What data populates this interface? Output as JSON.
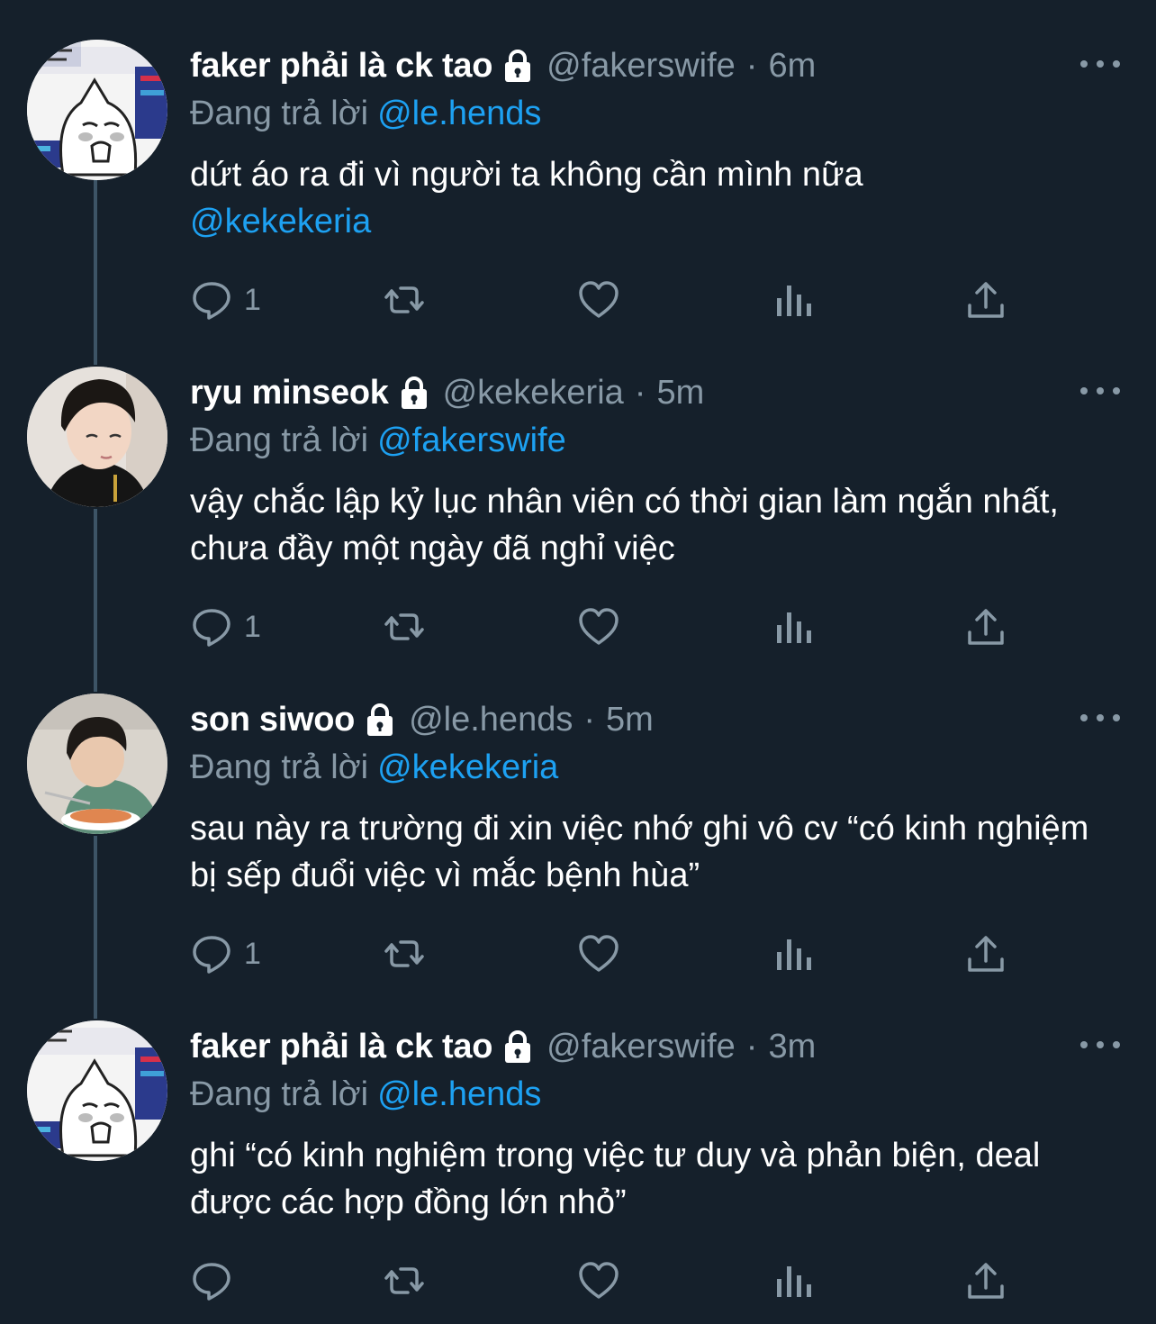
{
  "colors": {
    "background": "#15202b",
    "secondary_text": "#8899a6",
    "link": "#1da1f2",
    "thread_line": "#3d5466"
  },
  "icons": {
    "protected": "lock-icon",
    "more": "more-dots-icon",
    "reply": "reply-icon",
    "retweet": "retweet-icon",
    "like": "like-icon",
    "analytics": "analytics-icon",
    "share": "share-icon"
  },
  "tweets": [
    {
      "display_name": "faker phải là ck tao",
      "handle": "@fakerswife",
      "separator": "·",
      "time": "6m",
      "reply_prefix": "Đang trả lời",
      "reply_to": "@le.hends",
      "text": "dứt áo ra đi vì người ta không cần mình nữa",
      "text_mention": "@kekekeria",
      "reply_count": "1"
    },
    {
      "display_name": "ryu minseok",
      "handle": "@kekekeria",
      "separator": "·",
      "time": "5m",
      "reply_prefix": "Đang trả lời",
      "reply_to": "@fakerswife",
      "text": "vậy chắc lập kỷ lục nhân viên có thời gian làm ngắn nhất, chưa đầy một ngày đã nghỉ việc",
      "reply_count": "1"
    },
    {
      "display_name": "son siwoo",
      "handle": "@le.hends",
      "separator": "·",
      "time": "5m",
      "reply_prefix": "Đang trả lời",
      "reply_to": "@kekekeria",
      "text": "sau này ra trường đi xin việc nhớ ghi vô cv “có kinh nghiệm bị sếp đuổi việc vì mắc bệnh hùa”",
      "reply_count": "1"
    },
    {
      "display_name": "faker phải là ck tao",
      "handle": "@fakerswife",
      "separator": "·",
      "time": "3m",
      "reply_prefix": "Đang trả lời",
      "reply_to": "@le.hends",
      "text": "ghi “có kinh nghiệm trong việc tư duy và phản biện, deal được các hợp đồng lớn nhỏ”",
      "reply_count": ""
    }
  ]
}
